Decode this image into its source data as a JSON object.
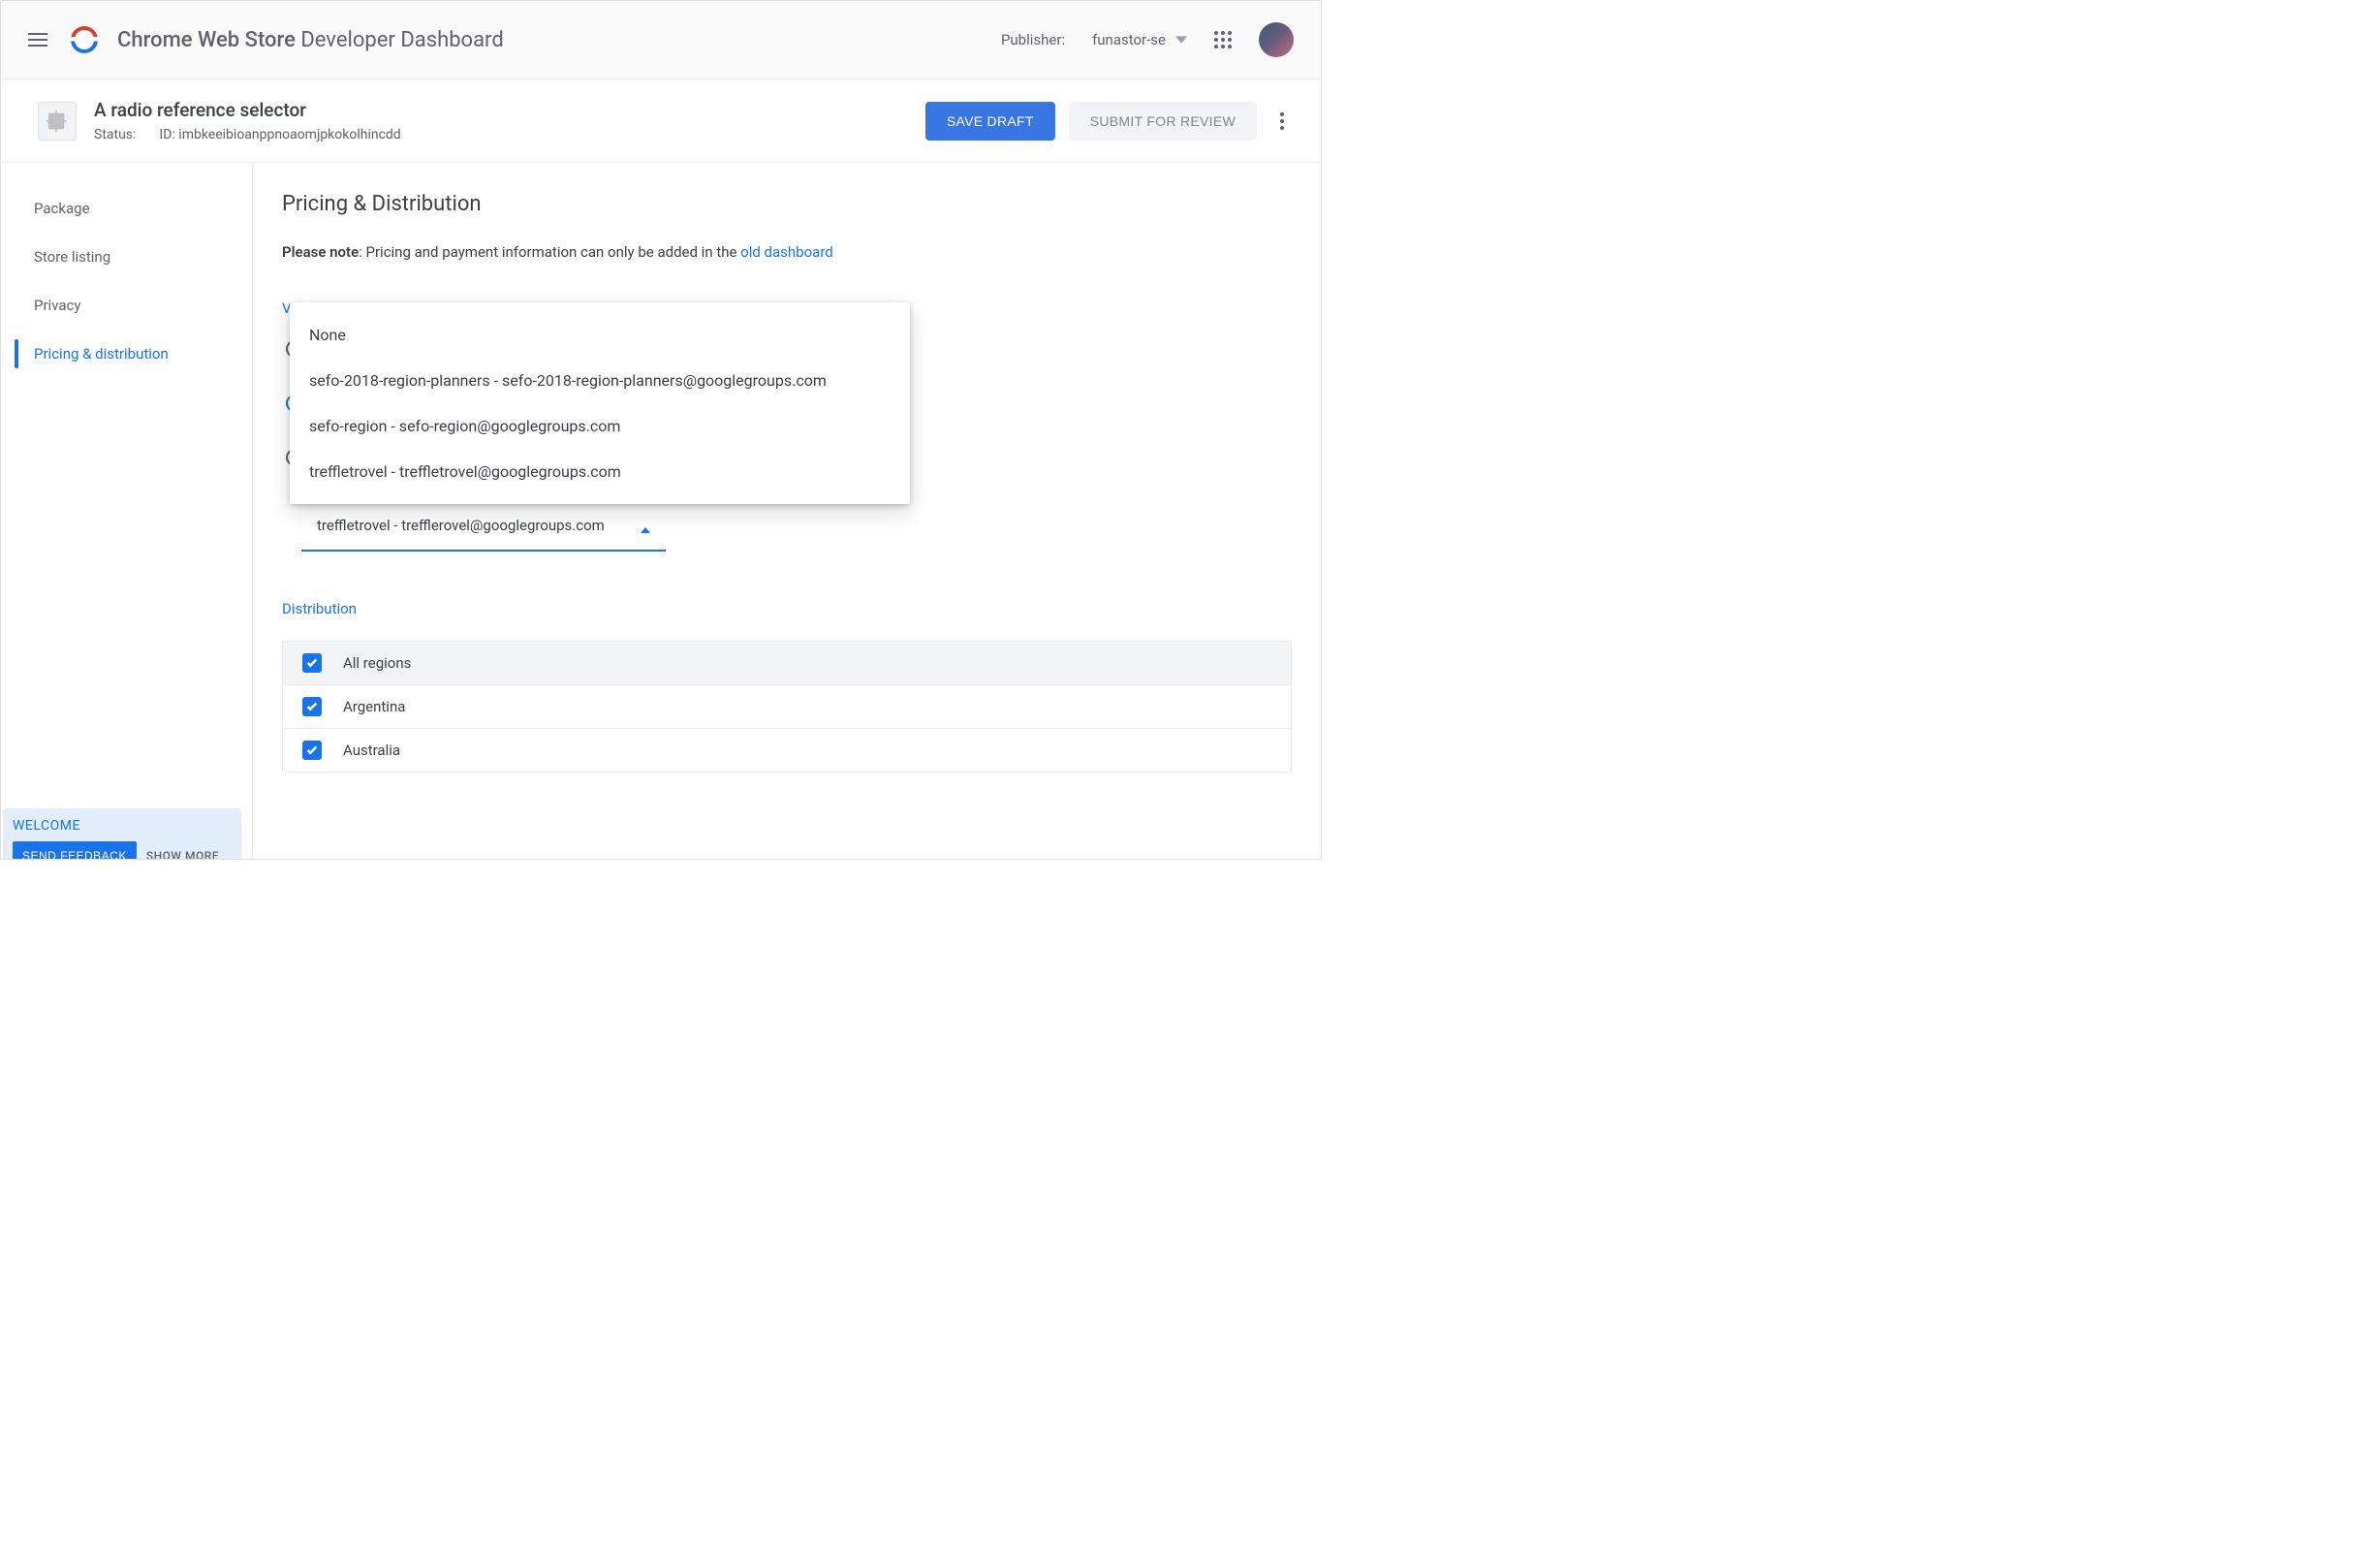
{
  "header": {
    "title_strong": "Chrome Web Store",
    "title_rest": "Developer Dashboard",
    "publisher_label": "Publisher:",
    "publisher_value": "funastor-se"
  },
  "item": {
    "name": "A radio reference selector",
    "status_label": "Status:",
    "id_label": "ID:",
    "id_value": "imbkeeibioanppnoaomjpkokolhincdd",
    "save_draft": "SAVE DRAFT",
    "submit_review": "SUBMIT FOR REVIEW"
  },
  "sidebar": {
    "items": [
      {
        "label": "Package",
        "active": false
      },
      {
        "label": "Store listing",
        "active": false
      },
      {
        "label": "Privacy",
        "active": false
      },
      {
        "label": "Pricing & distribution",
        "active": true
      }
    ]
  },
  "pricing": {
    "title": "Pricing & Distribution",
    "note_bold": "Please note",
    "note_rest": ": Pricing and payment information can only be added in the ",
    "note_link": "old dashboard",
    "visibility_header": "Visibility",
    "radios_selected_index": 1,
    "group_select_value": "treffletrovel - trefflerovel@googlegroups.com",
    "dropdown_options": [
      "None",
      "sefo-2018-region-planners - sefo-2018-region-planners@googlegroups.com",
      "sefo-region - sefo-region@googlegroups.com",
      "treffletrovel - treffletrovel@googlegroups.com"
    ],
    "distribution_header": "Distribution",
    "regions": [
      {
        "label": "All regions",
        "checked": true,
        "header": true
      },
      {
        "label": "Argentina",
        "checked": true,
        "header": false
      },
      {
        "label": "Australia",
        "checked": true,
        "header": false
      }
    ]
  },
  "welcome": {
    "title": "WELCOME",
    "send": "SEND FEEDBACK",
    "more": "SHOW MORE"
  }
}
